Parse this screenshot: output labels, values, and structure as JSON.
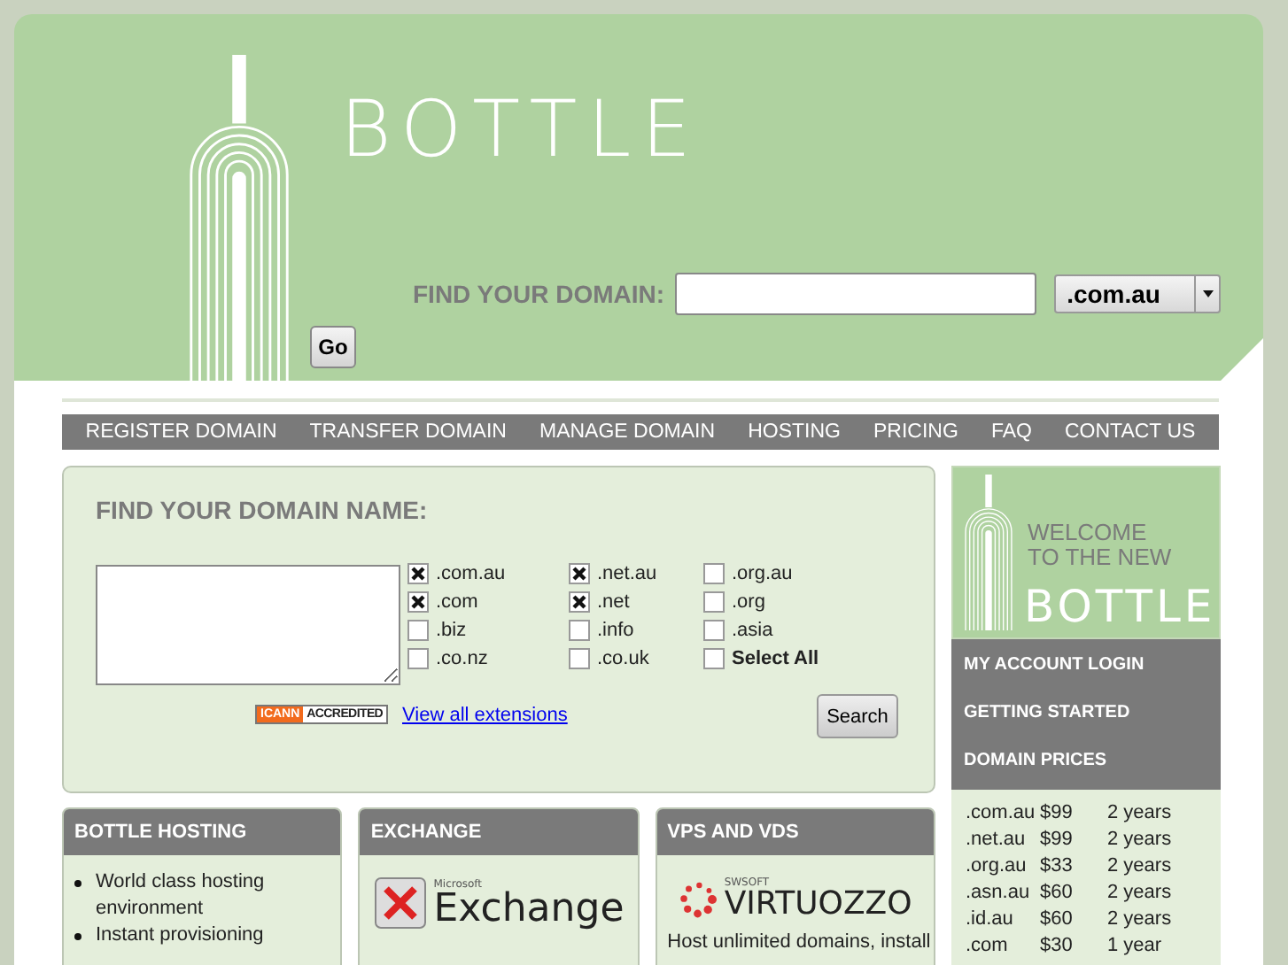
{
  "header": {
    "logo_text": "BOTTLE",
    "search_label": "FIND YOUR DOMAIN:",
    "extension": ".com.au",
    "go_button": "Go"
  },
  "nav": [
    "REGISTER DOMAIN",
    "TRANSFER DOMAIN",
    "MANAGE DOMAIN",
    "HOSTING",
    "PRICING",
    "FAQ",
    "CONTACT US"
  ],
  "search_panel": {
    "title": "FIND YOUR DOMAIN NAME:",
    "extensions": [
      {
        "label": ".com.au",
        "checked": true
      },
      {
        "label": ".net.au",
        "checked": true
      },
      {
        "label": ".org.au",
        "checked": false
      },
      {
        "label": ".com",
        "checked": true
      },
      {
        "label": ".net",
        "checked": true
      },
      {
        "label": ".org",
        "checked": false
      },
      {
        "label": ".biz",
        "checked": false
      },
      {
        "label": ".info",
        "checked": false
      },
      {
        "label": ".asia",
        "checked": false
      },
      {
        "label": ".co.nz",
        "checked": false
      },
      {
        "label": ".co.uk",
        "checked": false
      },
      {
        "label": "Select All",
        "checked": false,
        "kind": "all"
      }
    ],
    "badge_left": "ICANN",
    "badge_right": "ACCREDITED",
    "link": "View all extensions",
    "search_button": "Search"
  },
  "sidebar": {
    "banner_lines": [
      "WELCOME",
      "TO THE NEW"
    ],
    "banner_logo": "BOTTLE",
    "menu": [
      "MY ACCOUNT LOGIN",
      "GETTING STARTED",
      "DOMAIN PRICES"
    ],
    "prices": [
      {
        "ext": ".com.au",
        "price": "$99",
        "term": "2 years"
      },
      {
        "ext": ".net.au",
        "price": "$99",
        "term": "2 years"
      },
      {
        "ext": ".org.au",
        "price": "$33",
        "term": "2 years"
      },
      {
        "ext": ".asn.au",
        "price": "$60",
        "term": "2 years"
      },
      {
        "ext": ".id.au",
        "price": "$60",
        "term": "2 years"
      },
      {
        "ext": ".com",
        "price": "$30",
        "term": "1 year"
      }
    ]
  },
  "cards": [
    {
      "title": "BOTTLE HOSTING",
      "kind": "list",
      "items": [
        "World class hosting environment",
        "Instant provisioning"
      ]
    },
    {
      "title": "EXCHANGE",
      "kind": "exchange",
      "logo_small": "Microsoft",
      "logo_text": "Exchange"
    },
    {
      "title": "VPS AND VDS",
      "kind": "virtuozzo",
      "logo_small": "SWSOFT",
      "logo_text": "VIRTUOZZO",
      "text": "Host unlimited domains, install"
    }
  ]
}
